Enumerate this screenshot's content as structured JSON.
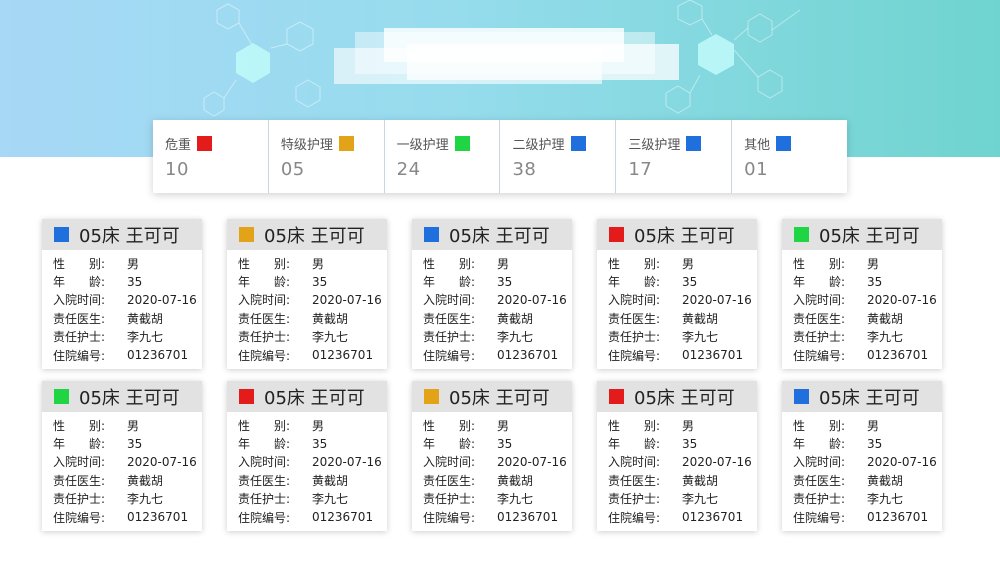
{
  "colors": {
    "critical": "#e31b1b",
    "special_care": "#e3a318",
    "level_1": "#1fd544",
    "level_2": "#1f6fdc",
    "level_3": "#1f6fdc",
    "other": "#1f6fdc"
  },
  "stats": [
    {
      "label": "危重",
      "value": "10",
      "color": "#e31b1b"
    },
    {
      "label": "特级护理",
      "value": "05",
      "color": "#e3a318"
    },
    {
      "label": "一级护理",
      "value": "24",
      "color": "#1fd544"
    },
    {
      "label": "二级护理",
      "value": "38",
      "color": "#1f6fdc"
    },
    {
      "label": "三级护理",
      "value": "17",
      "color": "#1f6fdc"
    },
    {
      "label": "其他",
      "value": "01",
      "color": "#1f6fdc"
    }
  ],
  "field_labels": {
    "gender": "性　　别:",
    "age": "年　　龄:",
    "admitted": "入院时间:",
    "doctor": "责任医生:",
    "nurse": "责任护士:",
    "record_no": "住院编号:"
  },
  "patients": [
    {
      "title": "05床 王可可",
      "color": "#1f6fdc",
      "gender": "男",
      "age": "35",
      "admitted": "2020-07-16",
      "doctor": "黄截胡",
      "nurse": "李九七",
      "record_no": "01236701"
    },
    {
      "title": "05床 王可可",
      "color": "#e3a318",
      "gender": "男",
      "age": "35",
      "admitted": "2020-07-16",
      "doctor": "黄截胡",
      "nurse": "李九七",
      "record_no": "01236701"
    },
    {
      "title": "05床 王可可",
      "color": "#1f6fdc",
      "gender": "男",
      "age": "35",
      "admitted": "2020-07-16",
      "doctor": "黄截胡",
      "nurse": "李九七",
      "record_no": "01236701"
    },
    {
      "title": "05床 王可可",
      "color": "#e31b1b",
      "gender": "男",
      "age": "35",
      "admitted": "2020-07-16",
      "doctor": "黄截胡",
      "nurse": "李九七",
      "record_no": "01236701"
    },
    {
      "title": "05床 王可可",
      "color": "#1fd544",
      "gender": "男",
      "age": "35",
      "admitted": "2020-07-16",
      "doctor": "黄截胡",
      "nurse": "李九七",
      "record_no": "01236701"
    },
    {
      "title": "05床 王可可",
      "color": "#1fd544",
      "gender": "男",
      "age": "35",
      "admitted": "2020-07-16",
      "doctor": "黄截胡",
      "nurse": "李九七",
      "record_no": "01236701"
    },
    {
      "title": "05床 王可可",
      "color": "#e31b1b",
      "gender": "男",
      "age": "35",
      "admitted": "2020-07-16",
      "doctor": "黄截胡",
      "nurse": "李九七",
      "record_no": "01236701"
    },
    {
      "title": "05床 王可可",
      "color": "#e3a318",
      "gender": "男",
      "age": "35",
      "admitted": "2020-07-16",
      "doctor": "黄截胡",
      "nurse": "李九七",
      "record_no": "01236701"
    },
    {
      "title": "05床 王可可",
      "color": "#e31b1b",
      "gender": "男",
      "age": "35",
      "admitted": "2020-07-16",
      "doctor": "黄截胡",
      "nurse": "李九七",
      "record_no": "01236701"
    },
    {
      "title": "05床 王可可",
      "color": "#1f6fdc",
      "gender": "男",
      "age": "35",
      "admitted": "2020-07-16",
      "doctor": "黄截胡",
      "nurse": "李九七",
      "record_no": "01236701"
    }
  ]
}
